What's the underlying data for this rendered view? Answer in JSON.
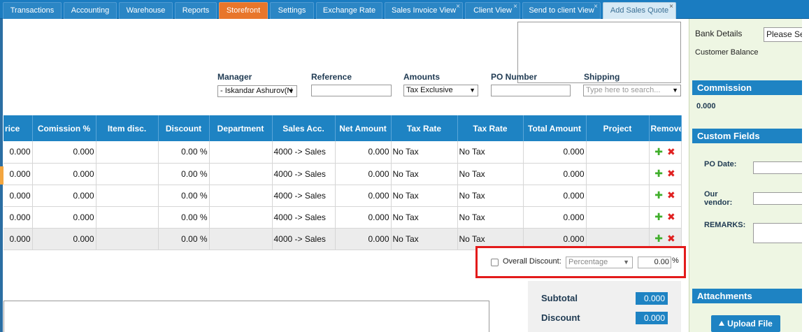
{
  "tabs": [
    {
      "label": "Transactions",
      "closable": false
    },
    {
      "label": "Accounting",
      "closable": false
    },
    {
      "label": "Warehouse",
      "closable": false
    },
    {
      "label": "Reports",
      "closable": false
    },
    {
      "label": "Storefront",
      "closable": false
    },
    {
      "label": "Settings",
      "closable": false
    },
    {
      "label": "Exchange Rate",
      "closable": false
    },
    {
      "label": "Sales Invoice View",
      "closable": true
    },
    {
      "label": "Client View",
      "closable": true
    },
    {
      "label": "Send to client View",
      "closable": true
    },
    {
      "label": "Add Sales Quote",
      "closable": true
    }
  ],
  "close_glyph": "×",
  "fields": {
    "manager": {
      "label": "Manager",
      "value": "- Iskandar Ashurov(N"
    },
    "reference": {
      "label": "Reference",
      "value": ""
    },
    "amounts": {
      "label": "Amounts",
      "value": "Tax Exclusive"
    },
    "po_number": {
      "label": "PO Number",
      "value": ""
    },
    "shipping": {
      "label": "Shipping",
      "placeholder": "Type here to search..."
    }
  },
  "table": {
    "headers": [
      "rice",
      "Comission %",
      "Item disc.",
      "Discount",
      "Department",
      "Sales Acc.",
      "Net Amount",
      "Tax Rate",
      "Tax Rate",
      "Total Amount",
      "Project",
      "Remove"
    ],
    "rows": [
      [
        "0.000",
        "0.000",
        "",
        "0.00 %",
        "",
        "4000 -> Sales",
        "0.000",
        "No Tax",
        "No Tax",
        "0.000",
        ""
      ],
      [
        "0.000",
        "0.000",
        "",
        "0.00 %",
        "",
        "4000 -> Sales",
        "0.000",
        "No Tax",
        "No Tax",
        "0.000",
        ""
      ],
      [
        "0.000",
        "0.000",
        "",
        "0.00 %",
        "",
        "4000 -> Sales",
        "0.000",
        "No Tax",
        "No Tax",
        "0.000",
        ""
      ],
      [
        "0.000",
        "0.000",
        "",
        "0.00 %",
        "",
        "4000 -> Sales",
        "0.000",
        "No Tax",
        "No Tax",
        "0.000",
        ""
      ],
      [
        "0.000",
        "0.000",
        "",
        "0.00 %",
        "",
        "4000 -> Sales",
        "0.000",
        "No Tax",
        "No Tax",
        "0.000",
        ""
      ]
    ],
    "add_icon": "✚",
    "remove_icon": "✖"
  },
  "overall_discount": {
    "label": "Overall Discount:",
    "type": "Percentage",
    "value": "0.00",
    "unit": "%",
    "checked": false
  },
  "totals": {
    "subtotal_label": "Subtotal",
    "subtotal": "0.000",
    "discount_label": "Discount",
    "discount": "0.000"
  },
  "sidebar": {
    "bank_details_label": "Bank Details",
    "bank_details_value": "Please Se",
    "customer_balance_label": "Customer Balance",
    "commission_title": "Commission",
    "commission_value": "0.000",
    "custom_fields_title": "Custom Fields",
    "po_date_label": "PO Date:",
    "our_vendor_label": "Our vendor:",
    "remarks_label": "REMARKS:",
    "attachments_title": "Attachments",
    "upload_label": "Upload File"
  },
  "colors": {
    "tabbar": "#1a7cc1",
    "header_blue": "#1e83c3",
    "storefront_orange": "#e8762b",
    "highlight_red": "#e31b1b",
    "sidebar_green": "#eef6e3"
  },
  "icons": {
    "caret": "▼",
    "upload": "🡅"
  }
}
